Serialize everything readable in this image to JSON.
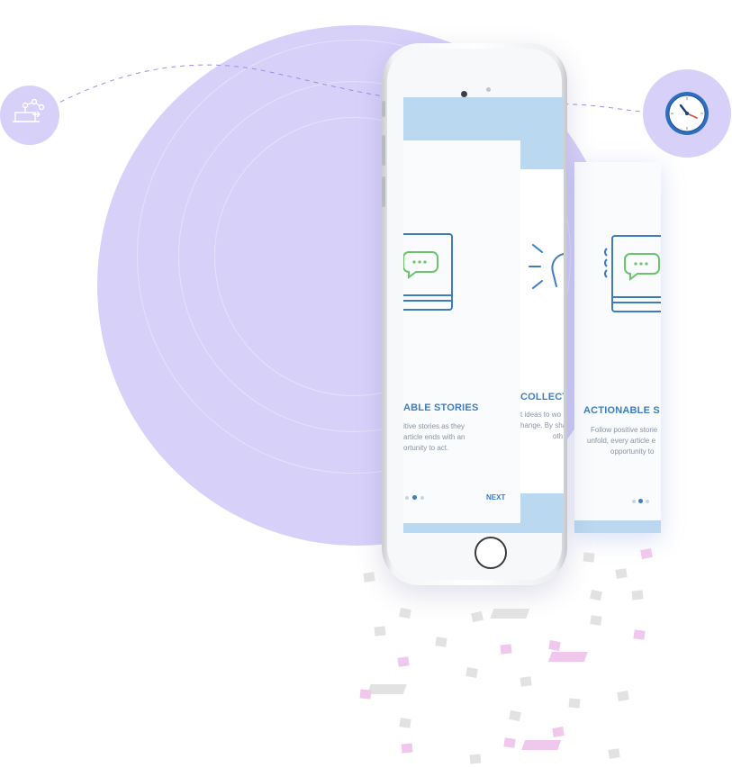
{
  "colors": {
    "circle": "#d7d1fa",
    "accent_blue": "#3d7dbf",
    "icon_green": "#6cc46a",
    "screen_band": "#bad8ef",
    "confetti_gray": "#e2e2e2",
    "confetti_pink": "#f0c8ee"
  },
  "icons": {
    "left_bubble": "workflow-icon",
    "right_bubble": "clock-icon",
    "card_icon": "notebook-chat-icon",
    "bulb_icon": "lightbulb-icon"
  },
  "phone_screen": {
    "card_main": {
      "title": "ABLE STORIES",
      "body_lines": [
        "itive stories as they",
        "article ends with an",
        "ortunity to act."
      ],
      "next_label": "NEXT",
      "page_indicator": {
        "count": 3,
        "active": 2
      }
    },
    "card_side": {
      "title": "COLLECT",
      "body_lines": [
        "t ideas to wo",
        "hange. By sha",
        "oth"
      ]
    }
  },
  "floating_card": {
    "title": "ACTIONABLE S",
    "body_lines": [
      "Follow positive storie",
      "unfold, every article e",
      "opportunity to"
    ],
    "page_indicator": {
      "count": 3,
      "active": 2
    }
  }
}
